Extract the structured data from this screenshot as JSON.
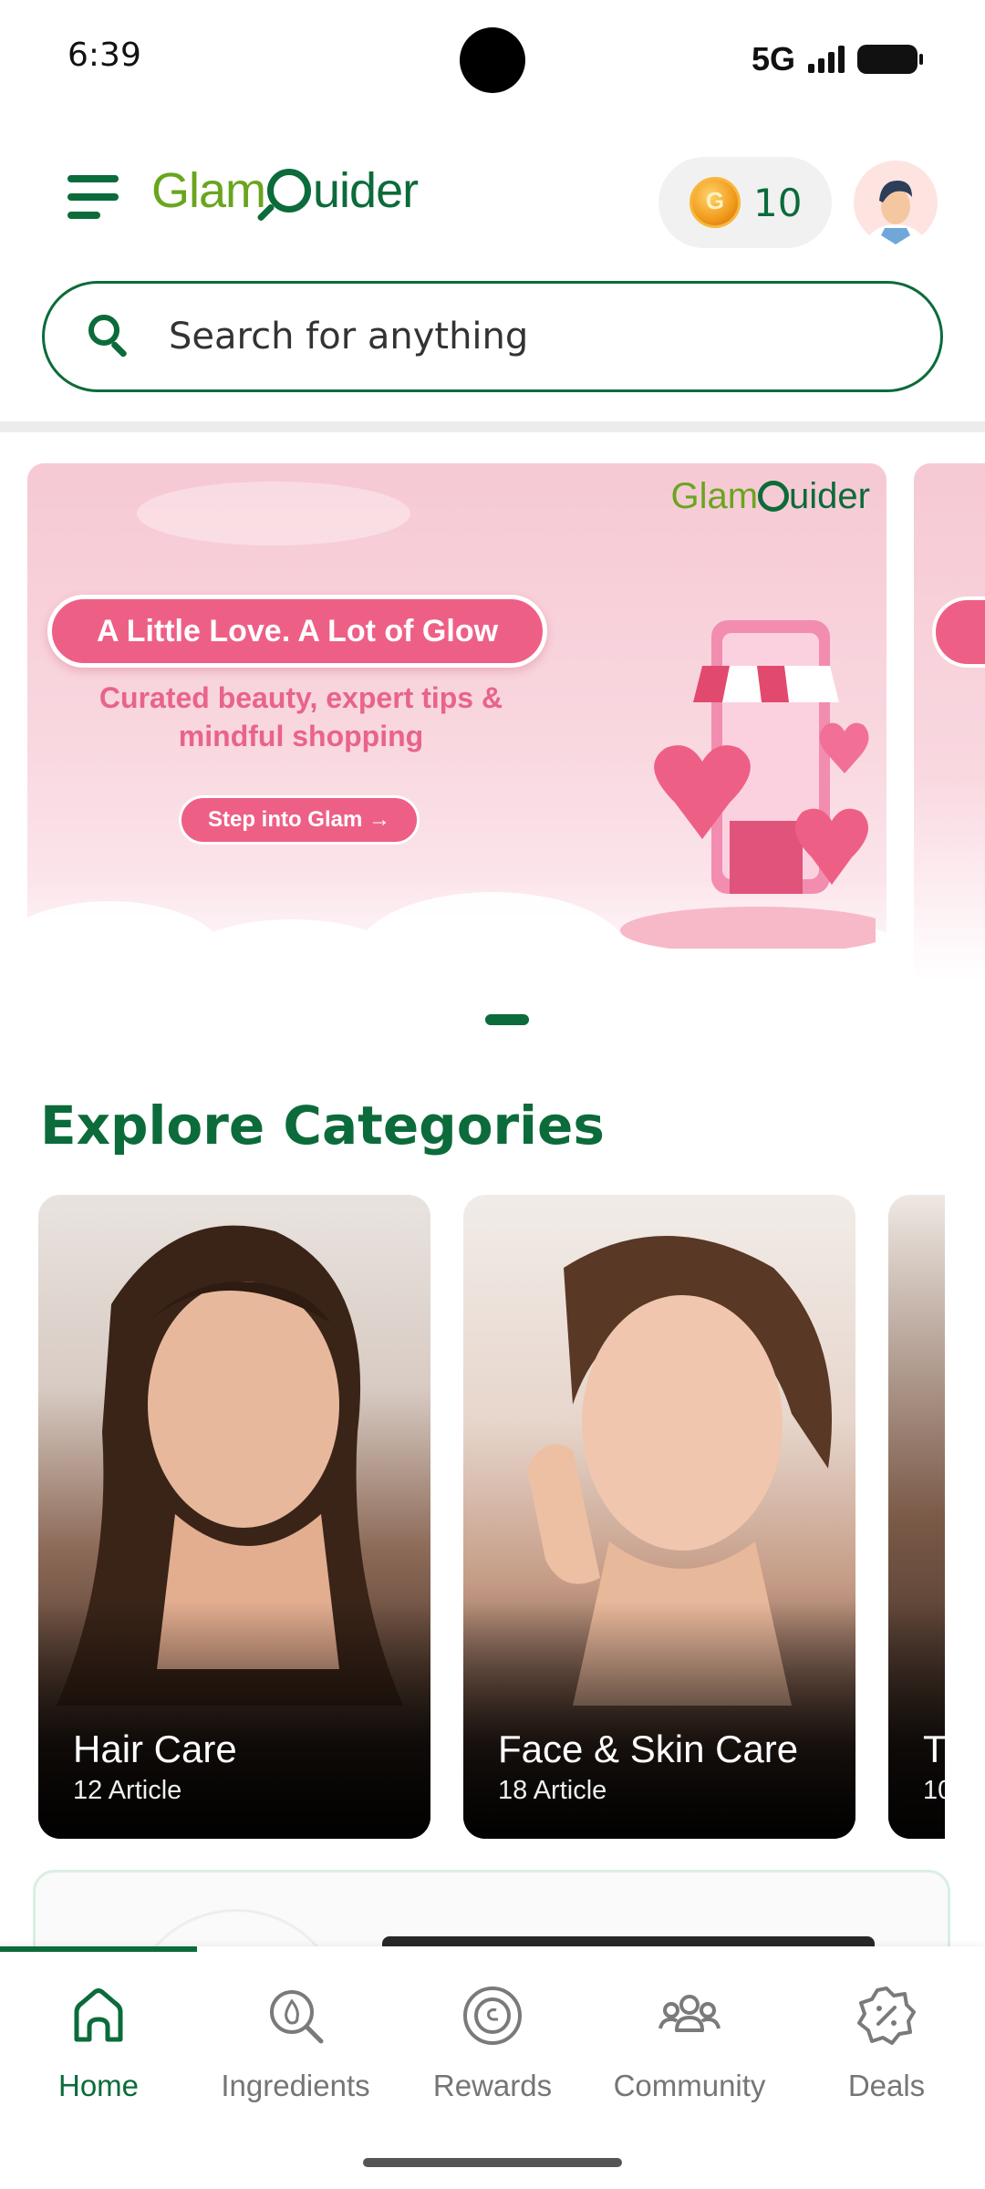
{
  "status_bar": {
    "time": "6:39",
    "network": "5G"
  },
  "header": {
    "logo_part1": "Glam",
    "logo_part2": "uider",
    "coins": "10"
  },
  "search": {
    "placeholder": "Search for anything"
  },
  "banner": {
    "logo_part1": "Glam",
    "logo_part2": "uider",
    "headline": "A Little Love. A Lot of Glow",
    "subtitle": "Curated beauty, expert tips & mindful shopping",
    "cta": "Step into Glam →"
  },
  "categories": {
    "title": "Explore Categories",
    "items": [
      {
        "name": "Hair Care",
        "count": "12 Article"
      },
      {
        "name": "Face & Skin Care",
        "count": "18 Article"
      },
      {
        "name": "T",
        "count": "10"
      }
    ]
  },
  "bottom_nav": {
    "items": [
      {
        "label": "Home",
        "icon": "home-icon"
      },
      {
        "label": "Ingredients",
        "icon": "ingredients-icon"
      },
      {
        "label": "Rewards",
        "icon": "rewards-icon"
      },
      {
        "label": "Community",
        "icon": "community-icon"
      },
      {
        "label": "Deals",
        "icon": "deals-icon"
      }
    ],
    "active_index": 0
  },
  "colors": {
    "brand_green": "#0c6b3a",
    "brand_light_green": "#6aa51e",
    "banner_pink": "#ee5f86"
  }
}
